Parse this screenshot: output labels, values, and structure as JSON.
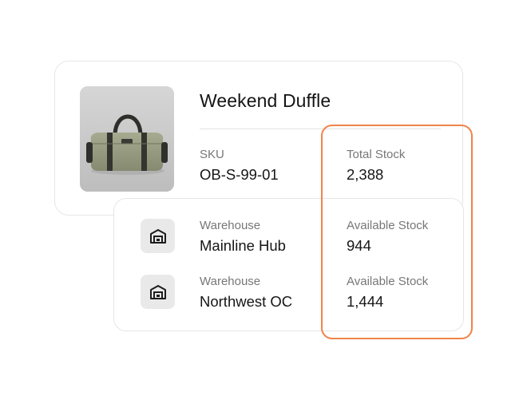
{
  "product": {
    "title": "Weekend Duffle",
    "image_alt": "olive green duffle bag",
    "sku_label": "SKU",
    "sku_value": "OB-S-99-01",
    "total_label": "Total Stock",
    "total_value": "2,388"
  },
  "warehouses": [
    {
      "label": "Warehouse",
      "name": "Mainline Hub",
      "stock_label": "Available Stock",
      "stock_value": "944",
      "icon": "warehouse-icon"
    },
    {
      "label": "Warehouse",
      "name": "Northwest OC",
      "stock_label": "Available Stock",
      "stock_value": "1,444",
      "icon": "warehouse-icon"
    }
  ],
  "colors": {
    "highlight": "#f0834a",
    "card_border": "#e6e6e6",
    "icon_bg": "#e9e9e9",
    "label_text": "#777777"
  }
}
